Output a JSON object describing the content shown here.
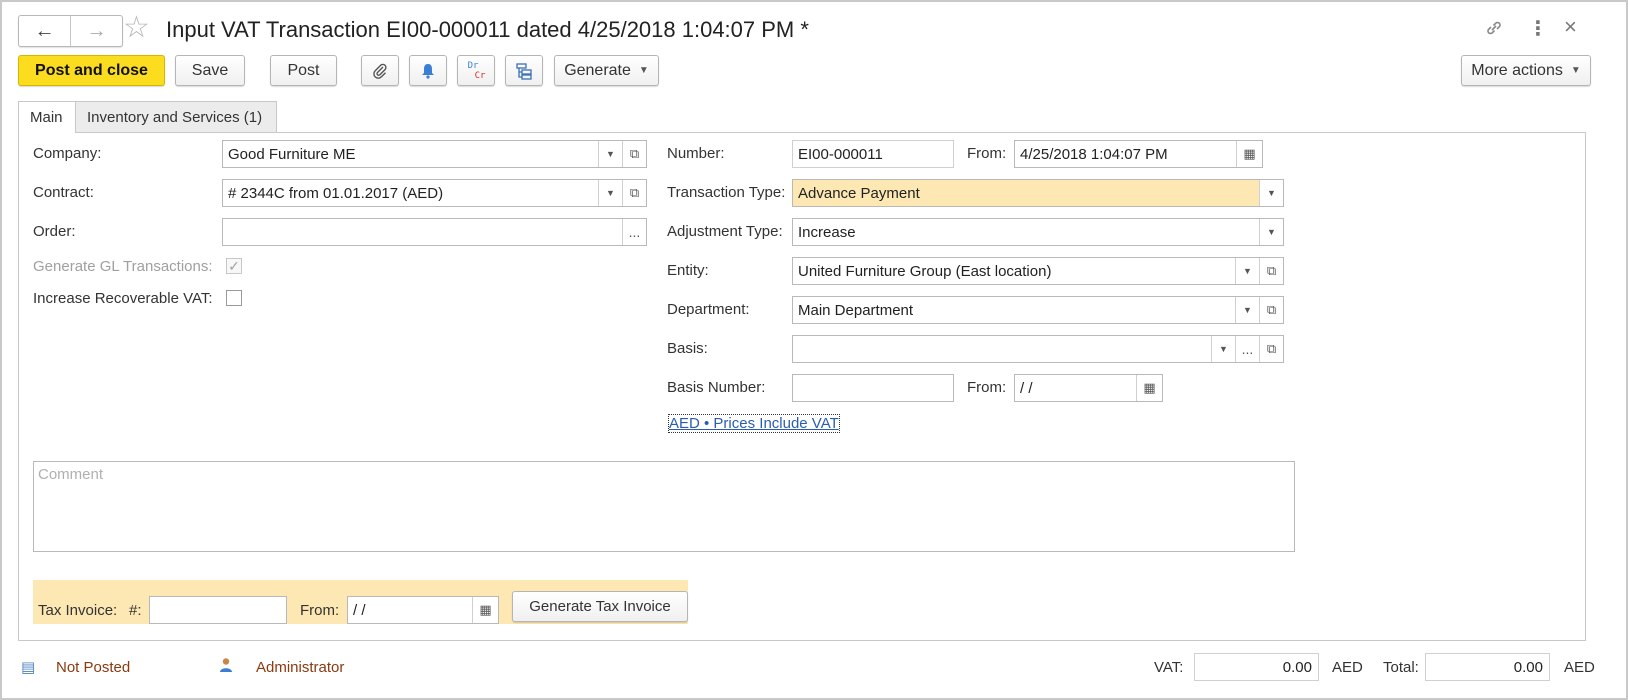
{
  "window": {
    "title": "Input VAT Transaction EI00-000011 dated 4/25/2018 1:04:07 PM *",
    "back_icon": "←",
    "forward_icon": "→",
    "star_icon": "☆",
    "link_icon": "🔗",
    "more_icon": "⋮",
    "close_icon": "×"
  },
  "toolbar": {
    "post_and_close": "Post and close",
    "save": "Save",
    "post": "Post",
    "attach_icon": "📎",
    "bell_icon": "🔔",
    "drcr_dr": "Dr",
    "drcr_cr": "Cr",
    "structure_icon": "⧉",
    "generate": "Generate",
    "more_actions": "More actions"
  },
  "tabs": [
    {
      "label": "Main"
    },
    {
      "label": "Inventory and Services (1)"
    }
  ],
  "form": {
    "company_label": "Company:",
    "company_value": "Good Furniture ME",
    "contract_label": "Contract:",
    "contract_value": "# 2344C from 01.01.2017 (AED)",
    "order_label": "Order:",
    "order_value": "",
    "generate_gl_label": "Generate GL Transactions:",
    "generate_gl_checked": "✓",
    "increase_vat_label": "Increase Recoverable VAT:",
    "number_label": "Number:",
    "number_value": "EI00-000011",
    "from_label": "From:",
    "from_value": "4/25/2018  1:04:07 PM",
    "transaction_type_label": "Transaction Type:",
    "transaction_type_value": "Advance Payment",
    "adjustment_type_label": "Adjustment Type:",
    "adjustment_type_value": "Increase",
    "entity_label": "Entity:",
    "entity_value": "United Furniture Group (East location)",
    "department_label": "Department:",
    "department_value": "Main Department",
    "basis_label": "Basis:",
    "basis_value": "",
    "basis_number_label": "Basis Number:",
    "basis_number_value": "",
    "basis_from_label": "From:",
    "basis_from_value": " /  /",
    "currency_link": "AED • Prices Include VAT",
    "comment_placeholder": "Comment"
  },
  "tax_invoice": {
    "label": "Tax Invoice:",
    "number_label": "#:",
    "number_value": "",
    "from_label": "From:",
    "from_value": " /  /",
    "generate_button": "Generate Tax Invoice"
  },
  "footer": {
    "status_icon": "▤",
    "status": "Not Posted",
    "user_icon": "👤",
    "user": "Administrator",
    "vat_label": "VAT:",
    "vat_value": "0.00",
    "vat_currency": "AED",
    "total_label": "Total:",
    "total_value": "0.00",
    "total_currency": "AED"
  },
  "glyphs": {
    "dropdown": "▼",
    "open": "⧉",
    "ellipsis": "...",
    "calendar": "▦"
  }
}
